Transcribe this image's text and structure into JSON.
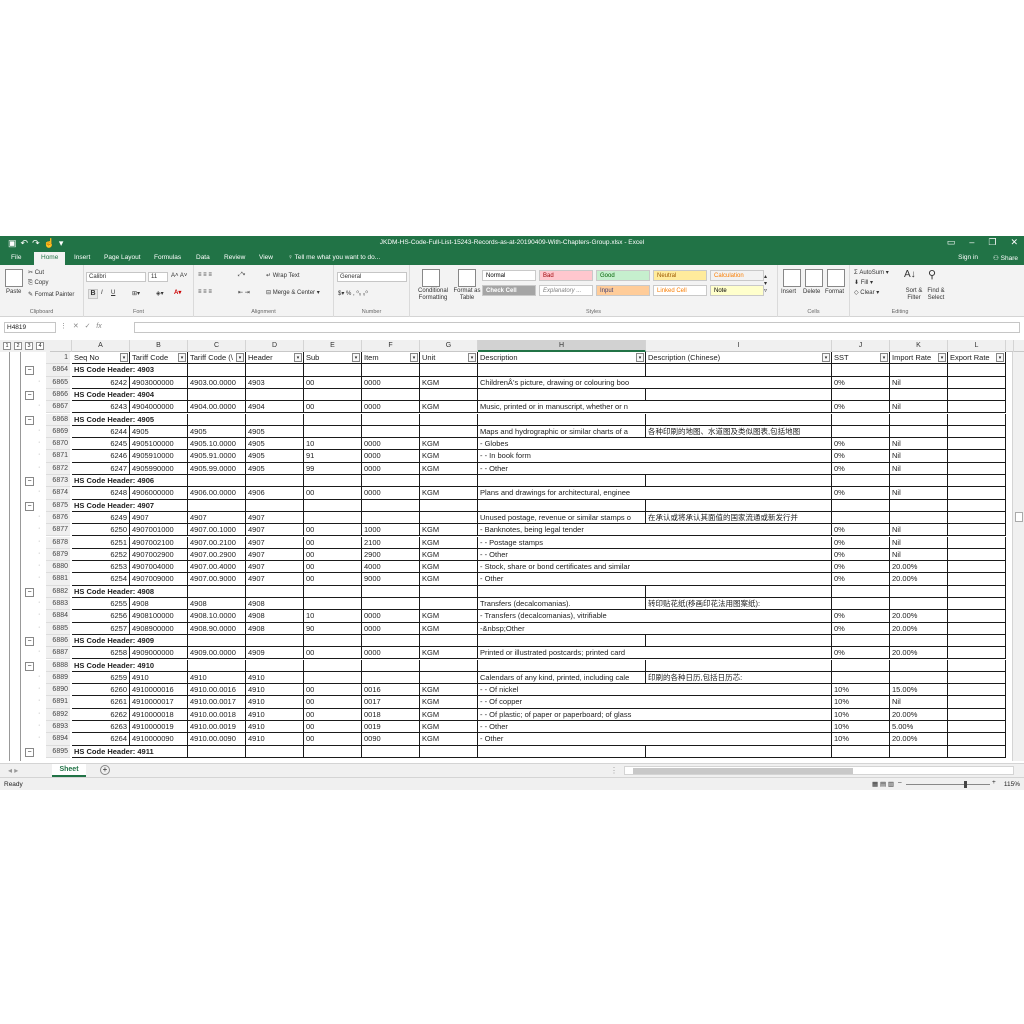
{
  "title": "JKDM-HS-Code-Full-List-15243-Records-as-at-20190409-With-Chapters-Group.xlsx - Excel",
  "ribbon_tabs": [
    "File",
    "Home",
    "Insert",
    "Page Layout",
    "Formulas",
    "Data",
    "Review",
    "View"
  ],
  "tell_me": "Tell me what you want to do...",
  "sign_in": "Sign in",
  "share": "Share",
  "clipboard": {
    "paste": "Paste",
    "cut": "Cut",
    "copy": "Copy",
    "painter": "Format Painter",
    "label": "Clipboard"
  },
  "font": {
    "name": "Calibri",
    "size": "11",
    "label": "Font"
  },
  "alignment": {
    "wrap": "Wrap Text",
    "merge": "Merge & Center",
    "label": "Alignment"
  },
  "number": {
    "format": "General",
    "label": "Number"
  },
  "styles": {
    "conditional": "Conditional Formatting",
    "format_table": "Format as Table",
    "items": [
      {
        "label": "Normal",
        "bg": "#ffffff",
        "fg": "#000000"
      },
      {
        "label": "Bad",
        "bg": "#ffc7ce",
        "fg": "#9c0006"
      },
      {
        "label": "Good",
        "bg": "#c6efce",
        "fg": "#006100"
      },
      {
        "label": "Neutral",
        "bg": "#ffeb9c",
        "fg": "#9c5700"
      },
      {
        "label": "Calculation",
        "bg": "#f2f2f2",
        "fg": "#fa7d00"
      },
      {
        "label": "Check Cell",
        "bg": "#a5a5a5",
        "fg": "#ffffff"
      },
      {
        "label": "Explanatory ...",
        "bg": "#ffffff",
        "fg": "#7f7f7f"
      },
      {
        "label": "Input",
        "bg": "#ffcc99",
        "fg": "#3f3f76"
      },
      {
        "label": "Linked Cell",
        "bg": "#ffffff",
        "fg": "#fa7d00"
      },
      {
        "label": "Note",
        "bg": "#ffffcc",
        "fg": "#000000"
      }
    ],
    "label": "Styles"
  },
  "cells": {
    "insert": "Insert",
    "delete": "Delete",
    "format": "Format",
    "label": "Cells"
  },
  "editing": {
    "autosum": "AutoSum",
    "fill": "Fill",
    "clear": "Clear",
    "sort": "Sort & Filter",
    "find": "Find & Select",
    "label": "Editing"
  },
  "name_box": "H4819",
  "outline_levels": [
    "1",
    "2",
    "3",
    "4"
  ],
  "columns": [
    "A",
    "B",
    "C",
    "D",
    "E",
    "F",
    "G",
    "H",
    "I",
    "J",
    "K",
    "L"
  ],
  "header_row_number": "1",
  "headers": [
    "Seq No",
    "Tariff Code",
    "Tariff Code (\\",
    "Header",
    "Sub",
    "Item",
    "Unit",
    "Description",
    "Description (Chinese)",
    "SST",
    "Import Rate",
    "Export Rate"
  ],
  "rows": [
    {
      "n": "6864",
      "h": "HS Code Header: 4903"
    },
    {
      "n": "6865",
      "c": [
        "6242",
        "4903000000",
        "4903.00.0000",
        "4903",
        "00",
        "0000",
        "KGM",
        "ChildrenÂ’s picture, drawing or colouring boo",
        "",
        "0%",
        "Nil",
        ""
      ]
    },
    {
      "n": "6866",
      "h": "HS Code Header: 4904"
    },
    {
      "n": "6867",
      "c": [
        "6243",
        "4904000000",
        "4904.00.0000",
        "4904",
        "00",
        "0000",
        "KGM",
        "Music, printed or in manuscript, whether or n",
        "",
        "0%",
        "Nil",
        ""
      ]
    },
    {
      "n": "6868",
      "h": "HS Code Header: 4905"
    },
    {
      "n": "6869",
      "c": [
        "6244",
        "4905",
        "4905",
        "4905",
        "",
        "",
        "",
        "Maps and hydrographic or similar charts of a",
        "各种印刷的地图、水道图及类似图表,包括地图",
        "",
        "",
        ""
      ]
    },
    {
      "n": "6870",
      "c": [
        "6245",
        "4905100000",
        "4905.10.0000",
        "4905",
        "10",
        "0000",
        "KGM",
        "- Globes",
        "",
        "0%",
        "Nil",
        ""
      ]
    },
    {
      "n": "6871",
      "c": [
        "6246",
        "4905910000",
        "4905.91.0000",
        "4905",
        "91",
        "0000",
        "KGM",
        "- -  In book form",
        "",
        "0%",
        "Nil",
        ""
      ]
    },
    {
      "n": "6872",
      "c": [
        "6247",
        "4905990000",
        "4905.99.0000",
        "4905",
        "99",
        "0000",
        "KGM",
        "- -  Other",
        "",
        "0%",
        "Nil",
        ""
      ]
    },
    {
      "n": "6873",
      "h": "HS Code Header: 4906"
    },
    {
      "n": "6874",
      "c": [
        "6248",
        "4906000000",
        "4906.00.0000",
        "4906",
        "00",
        "0000",
        "KGM",
        "Plans and drawings for architectural, enginee",
        "",
        "0%",
        "Nil",
        ""
      ]
    },
    {
      "n": "6875",
      "h": "HS Code Header: 4907"
    },
    {
      "n": "6876",
      "c": [
        "6249",
        "4907",
        "4907",
        "4907",
        "",
        "",
        "",
        "Unused postage, revenue or similar stamps o",
        "在承认或将承认其面值的国家流通或新发行并",
        "",
        "",
        ""
      ]
    },
    {
      "n": "6877",
      "c": [
        "6250",
        "4907001000",
        "4907.00.1000",
        "4907",
        "00",
        "1000",
        "KGM",
        "- Banknotes, being legal tender",
        "",
        "0%",
        "Nil",
        ""
      ]
    },
    {
      "n": "6878",
      "c": [
        "6251",
        "4907002100",
        "4907.00.2100",
        "4907",
        "00",
        "2100",
        "KGM",
        "- - Postage stamps",
        "",
        "0%",
        "Nil",
        ""
      ]
    },
    {
      "n": "6879",
      "c": [
        "6252",
        "4907002900",
        "4907.00.2900",
        "4907",
        "00",
        "2900",
        "KGM",
        "- - Other",
        "",
        "0%",
        "Nil",
        ""
      ]
    },
    {
      "n": "6880",
      "c": [
        "6253",
        "4907004000",
        "4907.00.4000",
        "4907",
        "00",
        "4000",
        "KGM",
        "- Stock, share or bond certificates and similar",
        "",
        "0%",
        "20.00%",
        ""
      ]
    },
    {
      "n": "6881",
      "c": [
        "6254",
        "4907009000",
        "4907.00.9000",
        "4907",
        "00",
        "9000",
        "KGM",
        "-  Other",
        "",
        "0%",
        "20.00%",
        ""
      ]
    },
    {
      "n": "6882",
      "h": "HS Code Header: 4908"
    },
    {
      "n": "6883",
      "c": [
        "6255",
        "4908",
        "4908",
        "4908",
        "",
        "",
        "",
        "Transfers (decalcomanias).",
        "转印贴花纸(移画印花法用图案纸):",
        "",
        "",
        ""
      ]
    },
    {
      "n": "6884",
      "c": [
        "6256",
        "4908100000",
        "4908.10.0000",
        "4908",
        "10",
        "0000",
        "KGM",
        "- Transfers (decalcomanias), vitrifiable",
        "",
        "0%",
        "20.00%",
        ""
      ]
    },
    {
      "n": "6885",
      "c": [
        "6257",
        "4908900000",
        "4908.90.0000",
        "4908",
        "90",
        "0000",
        "KGM",
        "-&nbsp;Other",
        "",
        "0%",
        "20.00%",
        ""
      ]
    },
    {
      "n": "6886",
      "h": "HS Code Header: 4909"
    },
    {
      "n": "6887",
      "c": [
        "6258",
        "4909000000",
        "4909.00.0000",
        "4909",
        "00",
        "0000",
        "KGM",
        "Printed or illustrated postcards; printed card",
        "",
        "0%",
        "20.00%",
        ""
      ]
    },
    {
      "n": "6888",
      "h": "HS Code Header: 4910"
    },
    {
      "n": "6889",
      "c": [
        "6259",
        "4910",
        "4910",
        "4910",
        "",
        "",
        "",
        "Calendars of any kind, printed, including cale",
        "印刷的各种日历,包括日历芯:",
        "",
        "",
        ""
      ]
    },
    {
      "n": "6890",
      "c": [
        "6260",
        "4910000016",
        "4910.00.0016",
        "4910",
        "00",
        "0016",
        "KGM",
        "- - Of nickel",
        "",
        "10%",
        "15.00%",
        ""
      ]
    },
    {
      "n": "6891",
      "c": [
        "6261",
        "4910000017",
        "4910.00.0017",
        "4910",
        "00",
        "0017",
        "KGM",
        "- - Of copper",
        "",
        "10%",
        "Nil",
        ""
      ]
    },
    {
      "n": "6892",
      "c": [
        "6262",
        "4910000018",
        "4910.00.0018",
        "4910",
        "00",
        "0018",
        "KGM",
        "- - Of plastic; of paper or paperboard; of glass",
        "",
        "10%",
        "20.00%",
        ""
      ]
    },
    {
      "n": "6893",
      "c": [
        "6263",
        "4910000019",
        "4910.00.0019",
        "4910",
        "00",
        "0019",
        "KGM",
        "- - Other",
        "",
        "10%",
        "5.00%",
        ""
      ]
    },
    {
      "n": "6894",
      "c": [
        "6264",
        "4910000090",
        "4910.00.0090",
        "4910",
        "00",
        "0090",
        "KGM",
        "-  Other",
        "",
        "10%",
        "20.00%",
        ""
      ]
    },
    {
      "n": "6895",
      "h": "HS Code Header: 4911"
    }
  ],
  "sheet_tab": "Sheet",
  "status": "Ready",
  "zoom": "115%"
}
